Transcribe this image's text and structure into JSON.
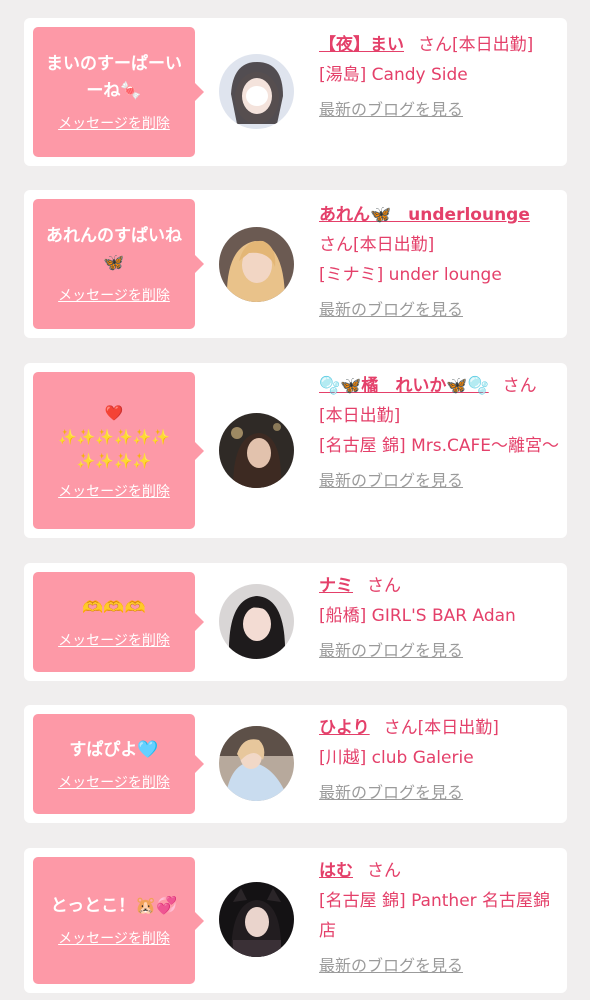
{
  "delete_label": "メッセージを削除",
  "blog_label": "最新のブログを見る",
  "colors": {
    "accent_pink": "#e4406a",
    "bubble_pink": "#fd99a7",
    "muted_gray": "#9b9b9b",
    "background": "#f0eeee"
  },
  "items": [
    {
      "message": "まいのすーぱーいーね🍬",
      "name": "【夜】まい",
      "suffix": "さん[本日出勤]",
      "area": "[湯島] Candy Side",
      "avatar": "avatar-mai"
    },
    {
      "message": "あれんのすぱいね🦋",
      "name": "あれん🦋　underlounge",
      "suffix": "さん[本日出勤]",
      "area": "[ミナミ] under lounge",
      "avatar": "avatar-aren"
    },
    {
      "message": "❤️\n✨✨✨✨✨✨\n✨✨✨✨",
      "name": "🫧🦋橘　れいか🦋🫧",
      "suffix": "さん[本日出勤]",
      "area": "[名古屋 錦] Mrs.CAFE〜離宮〜",
      "avatar": "avatar-reika"
    },
    {
      "message": "🫶🫶🫶",
      "name": "ナミ",
      "suffix": "さん",
      "area": "[船橋] GIRL'S BAR Adan",
      "avatar": "avatar-nami"
    },
    {
      "message": "すぱぴよ🩵",
      "name": "ひより",
      "suffix": "さん[本日出勤]",
      "area": "[川越] club Galerie",
      "avatar": "avatar-hiyori"
    },
    {
      "message": "とっとこ！🐹💞",
      "name": "はむ",
      "suffix": "さん",
      "area": "[名古屋 錦] Panther 名古屋錦店",
      "avatar": "avatar-hamu"
    }
  ]
}
